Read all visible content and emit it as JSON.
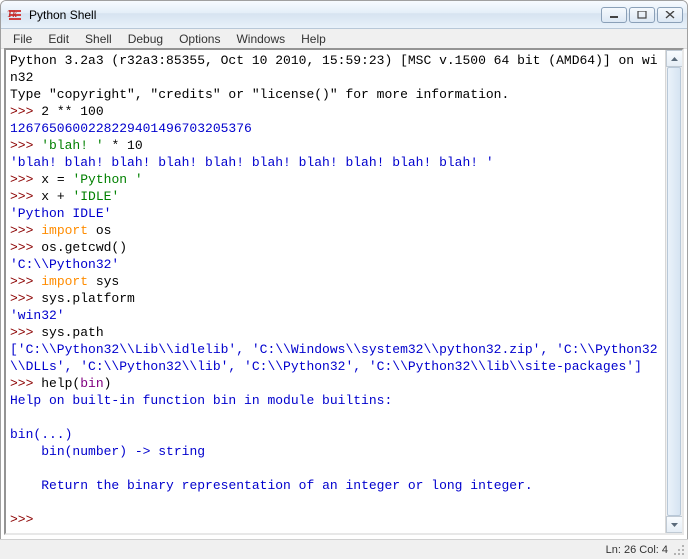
{
  "window": {
    "title": "Python Shell"
  },
  "menu": {
    "file": "File",
    "edit": "Edit",
    "shell": "Shell",
    "debug": "Debug",
    "options": "Options",
    "windows": "Windows",
    "help": "Help"
  },
  "shell": {
    "header1": "Python 3.2a3 (r32a3:85355, Oct 10 2010, 15:59:23) [MSC v.1500 64 bit (AMD64)] on win32",
    "header2": "Type \"copyright\", \"credits\" or \"license()\" for more information.",
    "prompt": ">>> ",
    "cmd1": "2 ** 100",
    "out1": "1267650600228229401496703205376",
    "cmd2_a": "'blah! '",
    "cmd2_b": " * 10",
    "out2": "'blah! blah! blah! blah! blah! blah! blah! blah! blah! blah! '",
    "cmd3_a": "x = ",
    "cmd3_b": "'Python '",
    "cmd4_a": "x + ",
    "cmd4_b": "'IDLE'",
    "out4": "'Python IDLE'",
    "cmd5_a": "import",
    "cmd5_b": " os",
    "cmd6": "os.getcwd()",
    "out6": "'C:\\\\Python32'",
    "cmd7_a": "import",
    "cmd7_b": " sys",
    "cmd8": "sys.platform",
    "out8": "'win32'",
    "cmd9": "sys.path",
    "out9": "['C:\\\\Python32\\\\Lib\\\\idlelib', 'C:\\\\Windows\\\\system32\\\\python32.zip', 'C:\\\\Python32\\\\DLLs', 'C:\\\\Python32\\\\lib', 'C:\\\\Python32', 'C:\\\\Python32\\\\lib\\\\site-packages']",
    "cmd10_a": "help(",
    "cmd10_b": "bin",
    "cmd10_c": ")",
    "help1": "Help on built-in function bin in module builtins:",
    "help2": "bin(...)",
    "help3": "    bin(number) -> string",
    "help4": "    Return the binary representation of an integer or long integer."
  },
  "status": {
    "position": "Ln: 26 Col: 4"
  }
}
